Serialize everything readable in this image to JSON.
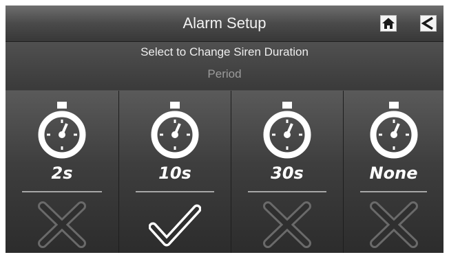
{
  "header": {
    "title": "Alarm Setup",
    "home_icon": "home-icon",
    "back_icon": "back-arrow-icon"
  },
  "prompt": {
    "instruction": "Select to Change Siren Duration",
    "field_label": "Period"
  },
  "options": [
    {
      "label": "2s",
      "selected": false,
      "icon": "stopwatch-icon"
    },
    {
      "label": "10s",
      "selected": true,
      "icon": "stopwatch-icon"
    },
    {
      "label": "30s",
      "selected": false,
      "icon": "stopwatch-icon"
    },
    {
      "label": "None",
      "selected": false,
      "icon": "stopwatch-icon"
    }
  ],
  "colors": {
    "selected_mark": "#ffffff",
    "unselected_mark": "#6a6a6a"
  }
}
